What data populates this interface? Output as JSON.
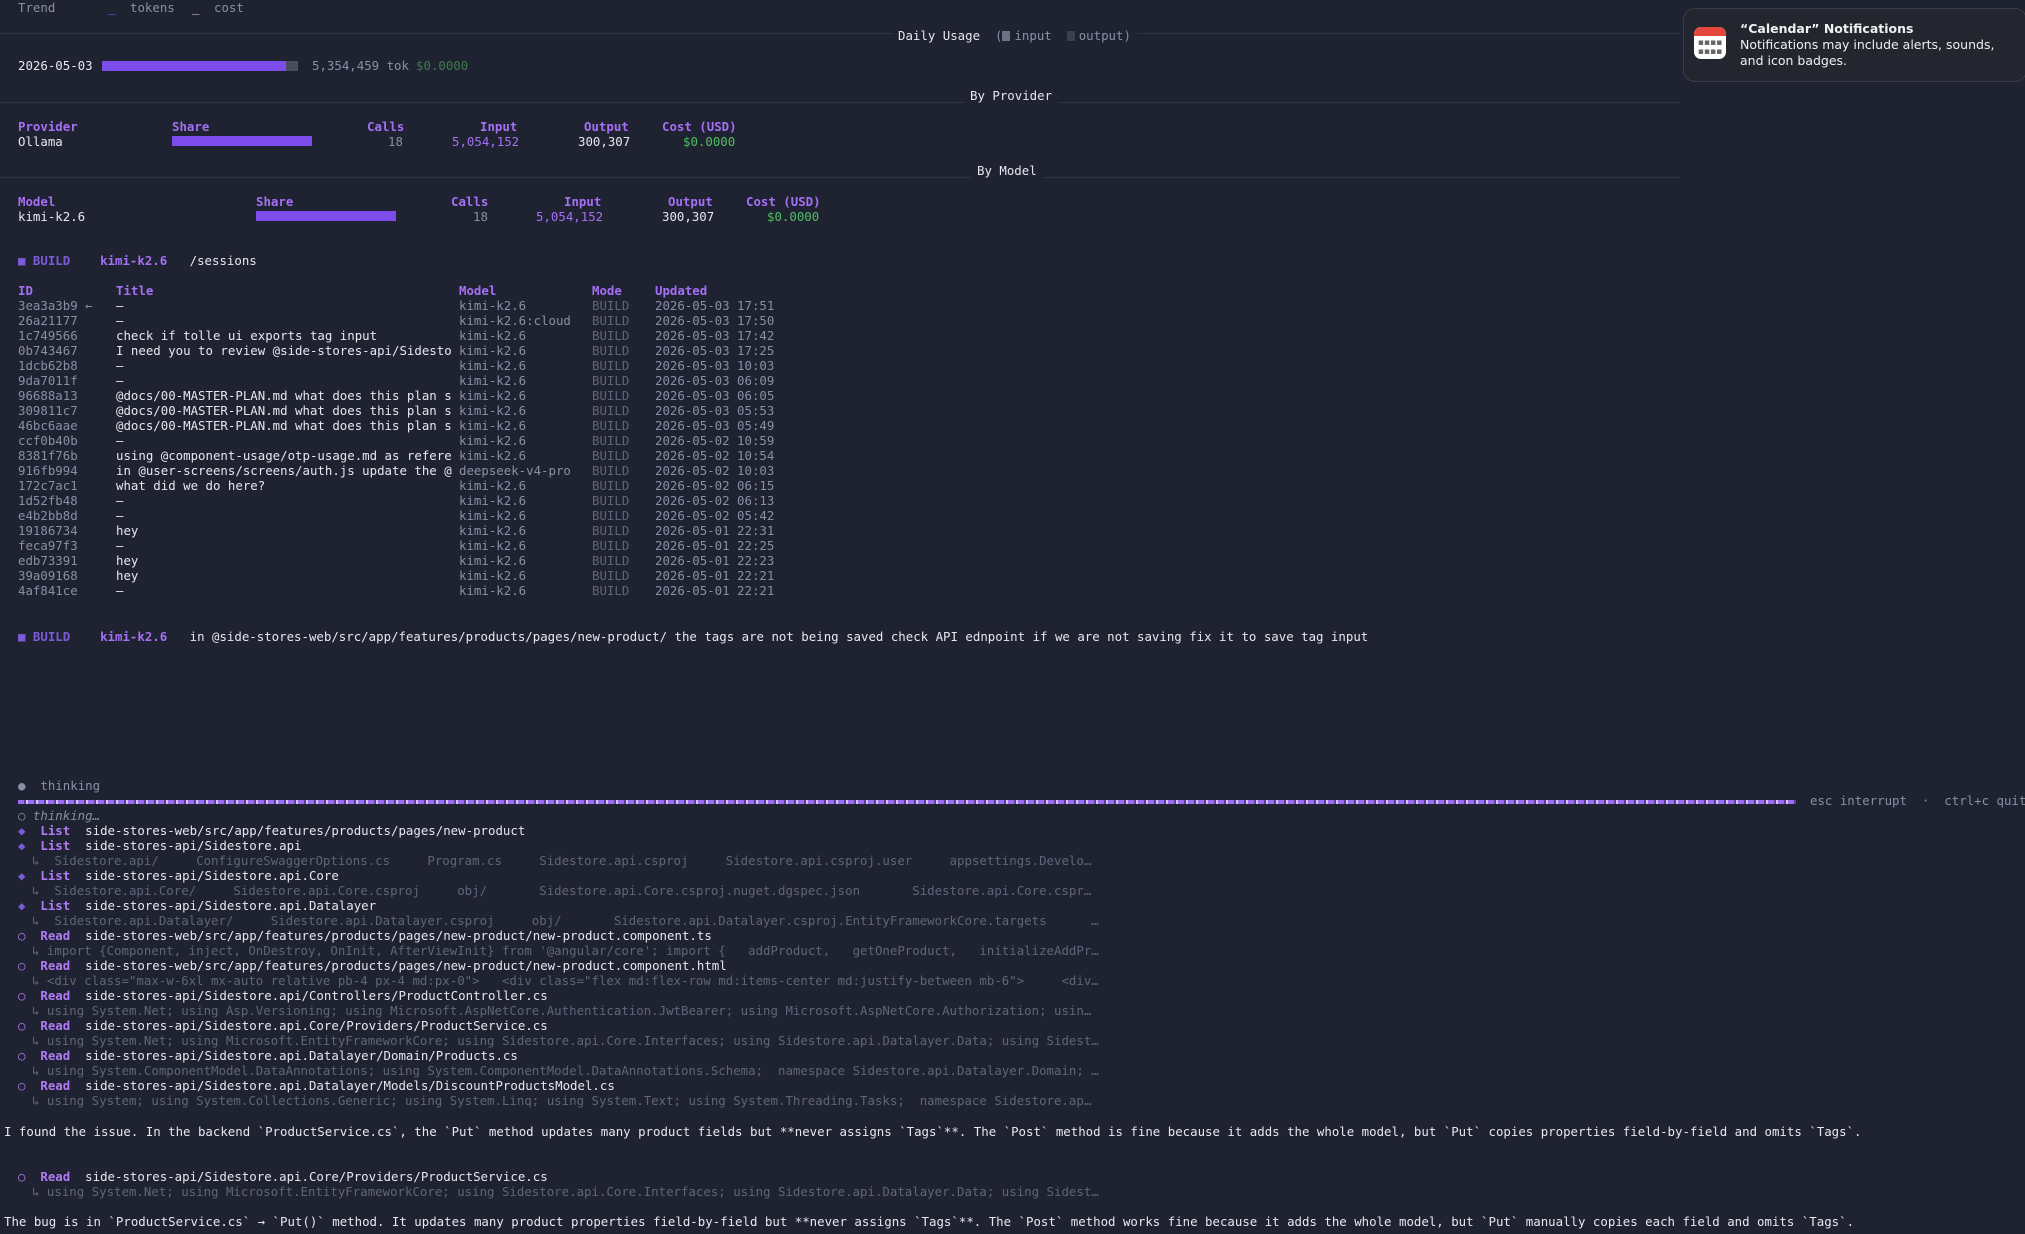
{
  "top_legend": {
    "trend": "Trend",
    "tokens": "tokens",
    "cost": "cost"
  },
  "daily": {
    "title": "Daily Usage",
    "legend_input": "input",
    "legend_output": "output",
    "date": "2026-05-03",
    "tokens": "5,354,459 tok",
    "cost": "$0.0000",
    "input_fraction": 0.94
  },
  "by_provider": {
    "title": "By Provider",
    "headers": [
      "Provider",
      "Share",
      "Calls",
      "Input",
      "Output",
      "Cost (USD)"
    ],
    "row": {
      "name": "Ollama",
      "share": 1.0,
      "calls": "18",
      "input": "5,054,152",
      "output": "300,307",
      "cost": "$0.0000"
    }
  },
  "by_model": {
    "title": "By Model",
    "headers": [
      "Model",
      "Share",
      "Calls",
      "Input",
      "Output",
      "Cost (USD)"
    ],
    "row": {
      "name": "kimi-k2.6",
      "share": 1.0,
      "calls": "18",
      "input": "5,054,152",
      "output": "300,307",
      "cost": "$0.0000"
    }
  },
  "prompt1": {
    "mode": "BUILD",
    "model": "kimi-k2.6",
    "text": "/sessions"
  },
  "sessions": {
    "headers": [
      "ID",
      "Title",
      "Model",
      "Mode",
      "Updated"
    ],
    "rows": [
      {
        "id": "3ea3a3b9 ←",
        "title": "—",
        "model": "kimi-k2.6",
        "mode": "BUILD",
        "updated": "2026-05-03 17:51"
      },
      {
        "id": "26a21177",
        "title": "—",
        "model": "kimi-k2.6:cloud",
        "mode": "BUILD",
        "updated": "2026-05-03 17:50"
      },
      {
        "id": "1c749566",
        "title": "check if tolle ui exports tag input",
        "model": "kimi-k2.6",
        "mode": "BUILD",
        "updated": "2026-05-03 17:42"
      },
      {
        "id": "0b743467",
        "title": "I need you to review @side-stores-api/Sidesto",
        "model": "kimi-k2.6",
        "mode": "BUILD",
        "updated": "2026-05-03 17:25"
      },
      {
        "id": "1dcb62b8",
        "title": "—",
        "model": "kimi-k2.6",
        "mode": "BUILD",
        "updated": "2026-05-03 10:03"
      },
      {
        "id": "9da7011f",
        "title": "—",
        "model": "kimi-k2.6",
        "mode": "BUILD",
        "updated": "2026-05-03 06:09"
      },
      {
        "id": "96688a13",
        "title": "@docs/00-MASTER-PLAN.md what does this plan s",
        "model": "kimi-k2.6",
        "mode": "BUILD",
        "updated": "2026-05-03 06:05"
      },
      {
        "id": "309811c7",
        "title": "@docs/00-MASTER-PLAN.md what does this plan s",
        "model": "kimi-k2.6",
        "mode": "BUILD",
        "updated": "2026-05-03 05:53"
      },
      {
        "id": "46bc6aae",
        "title": "@docs/00-MASTER-PLAN.md what does this plan s",
        "model": "kimi-k2.6",
        "mode": "BUILD",
        "updated": "2026-05-03 05:49"
      },
      {
        "id": "ccf0b40b",
        "title": "—",
        "model": "kimi-k2.6",
        "mode": "BUILD",
        "updated": "2026-05-02 10:59"
      },
      {
        "id": "8381f76b",
        "title": "using @component-usage/otp-usage.md as refere",
        "model": "kimi-k2.6",
        "mode": "BUILD",
        "updated": "2026-05-02 10:54"
      },
      {
        "id": "916fb994",
        "title": "in @user-screens/screens/auth.js update the @",
        "model": "deepseek-v4-pro",
        "mode": "BUILD",
        "updated": "2026-05-02 10:03"
      },
      {
        "id": "172c7ac1",
        "title": "what did we do here?",
        "model": "kimi-k2.6",
        "mode": "BUILD",
        "updated": "2026-05-02 06:15"
      },
      {
        "id": "1d52fb48",
        "title": "—",
        "model": "kimi-k2.6",
        "mode": "BUILD",
        "updated": "2026-05-02 06:13"
      },
      {
        "id": "e4b2bb8d",
        "title": "—",
        "model": "kimi-k2.6",
        "mode": "BUILD",
        "updated": "2026-05-02 05:42"
      },
      {
        "id": "19186734",
        "title": "hey",
        "model": "kimi-k2.6",
        "mode": "BUILD",
        "updated": "2026-05-01 22:31"
      },
      {
        "id": "feca97f3",
        "title": "—",
        "model": "kimi-k2.6",
        "mode": "BUILD",
        "updated": "2026-05-01 22:25"
      },
      {
        "id": "edb73391",
        "title": "hey",
        "model": "kimi-k2.6",
        "mode": "BUILD",
        "updated": "2026-05-01 22:23"
      },
      {
        "id": "39a09168",
        "title": "hey",
        "model": "kimi-k2.6",
        "mode": "BUILD",
        "updated": "2026-05-01 22:21"
      },
      {
        "id": "4af841ce",
        "title": "—",
        "model": "kimi-k2.6",
        "mode": "BUILD",
        "updated": "2026-05-01 22:21"
      }
    ]
  },
  "prompt2": {
    "mode": "BUILD",
    "model": "kimi-k2.6",
    "text": "in @side-stores-web/src/app/features/products/pages/new-product/ the tags are not being saved check API ednpoint if we are not saving fix it to save tag input"
  },
  "status": {
    "thinking": "thinking",
    "hint": "esc interrupt  ·  ctrl+c quit",
    "thinking_line": "thinking…"
  },
  "log": [
    {
      "icon": "◆",
      "tool": "List",
      "path": "side-stores-web/src/app/features/products/pages/new-product",
      "detail": ""
    },
    {
      "icon": "◆",
      "tool": "List",
      "path": "side-stores-api/Sidestore.api",
      "detail": "↳  Sidestore.api/     ConfigureSwaggerOptions.cs     Program.cs     Sidestore.api.csproj     Sidestore.api.csproj.user     appsettings.Develo…"
    },
    {
      "icon": "◆",
      "tool": "List",
      "path": "side-stores-api/Sidestore.api.Core",
      "detail": "↳  Sidestore.api.Core/     Sidestore.api.Core.csproj     obj/       Sidestore.api.Core.csproj.nuget.dgspec.json       Sidestore.api.Core.cspr…"
    },
    {
      "icon": "◆",
      "tool": "List",
      "path": "side-stores-api/Sidestore.api.Datalayer",
      "detail": "↳  Sidestore.api.Datalayer/     Sidestore.api.Datalayer.csproj     obj/       Sidestore.api.Datalayer.csproj.EntityFrameworkCore.targets      …"
    },
    {
      "icon": "○",
      "tool": "Read",
      "path": "side-stores-web/src/app/features/products/pages/new-product/new-product.component.ts",
      "detail": "↳ import {Component, inject, OnDestroy, OnInit, AfterViewInit} from '@angular/core'; import {   addProduct,   getOneProduct,   initializeAddPr…"
    },
    {
      "icon": "○",
      "tool": "Read",
      "path": "side-stores-web/src/app/features/products/pages/new-product/new-product.component.html",
      "detail": "↳ <div class=\"max-w-6xl mx-auto relative pb-4 px-4 md:px-0\">   <div class=\"flex md:flex-row md:items-center md:justify-between mb-6\">     <div…"
    },
    {
      "icon": "○",
      "tool": "Read",
      "path": "side-stores-api/Sidestore.api/Controllers/ProductController.cs",
      "detail": "↳ using System.Net; using Asp.Versioning; using Microsoft.AspNetCore.Authentication.JwtBearer; using Microsoft.AspNetCore.Authorization; usin…"
    },
    {
      "icon": "○",
      "tool": "Read",
      "path": "side-stores-api/Sidestore.api.Core/Providers/ProductService.cs",
      "detail": "↳ using System.Net; using Microsoft.EntityFrameworkCore; using Sidestore.api.Core.Interfaces; using Sidestore.api.Datalayer.Data; using Sidest…"
    },
    {
      "icon": "○",
      "tool": "Read",
      "path": "side-stores-api/Sidestore.api.Datalayer/Domain/Products.cs",
      "detail": "↳ using System.ComponentModel.DataAnnotations; using System.ComponentModel.DataAnnotations.Schema;  namespace Sidestore.api.Datalayer.Domain; …"
    },
    {
      "icon": "○",
      "tool": "Read",
      "path": "side-stores-api/Sidestore.api.Datalayer/Models/DiscountProductsModel.cs",
      "detail": "↳ using System; using System.Collections.Generic; using System.Linq; using System.Text; using System.Threading.Tasks;  namespace Sidestore.ap…"
    }
  ],
  "message1": "I found the issue. In the backend `ProductService.cs`, the `Put` method updates many product fields but **never assigns `Tags`**. The `Post` method is fine because it adds the whole model, but `Put` copies properties field-by-field and omits `Tags`.",
  "log2": {
    "icon": "○",
    "tool": "Read",
    "path": "side-stores-api/Sidestore.api.Core/Providers/ProductService.cs",
    "detail": "↳ using System.Net; using Microsoft.EntityFrameworkCore; using Sidestore.api.Core.Interfaces; using Sidestore.api.Datalayer.Data; using Sidest…"
  },
  "message2": "The bug is in `ProductService.cs` → `Put()` method. It updates many product properties field-by-field but **never assigns `Tags`**. The `Post` method works fine because it adds the whole model, but `Put` manually copies each field and omits `Tags`.",
  "notification": {
    "title": "“Calendar” Notifications",
    "message": "Notifications may include alerts, sounds, and icon badges.",
    "icon": "calendar-icon"
  },
  "colors": {
    "accent": "#7c4dea",
    "green": "#4fbf62",
    "background": "#1f2230"
  }
}
